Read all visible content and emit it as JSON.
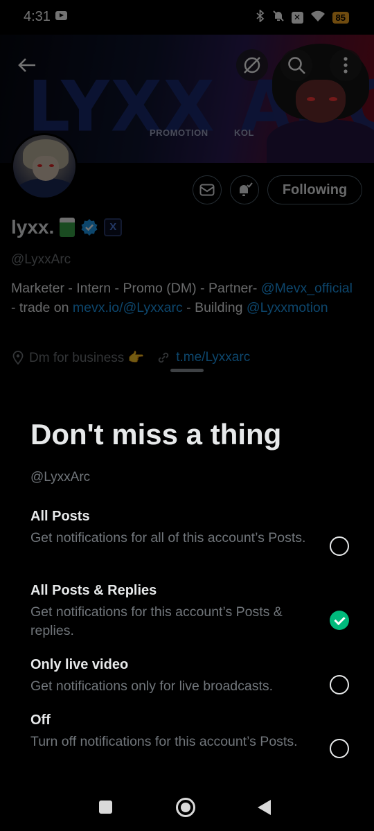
{
  "status_bar": {
    "time": "4:31",
    "battery": "85",
    "icons": [
      "youtube-icon",
      "bluetooth-icon",
      "bell-off-icon",
      "x-app-icon",
      "wifi-icon",
      "battery-icon"
    ]
  },
  "banner": {
    "title": "LYXX ARC",
    "tags": [
      "PROMOTION",
      "KOL"
    ]
  },
  "profile": {
    "name": "lyxx.",
    "handle": "@LyxxArc",
    "bio": {
      "part1": "Marketer - Intern - Promo (DM) - Partner- ",
      "link1": "@Mevx_official",
      "part2": " - trade on ",
      "link2": "mevx.io/@Lyxxarc",
      "part3": " - Building ",
      "link3": "@Lyxxmotion"
    },
    "location": "Dm for business 👉",
    "url": "t.me/Lyxxarc",
    "following_label": "Following",
    "badge_label": "X"
  },
  "sheet": {
    "title": "Don't miss a thing",
    "handle": "@LyxxArc",
    "options": [
      {
        "title": "All Posts",
        "desc": "Get notifications for all of this account’s Posts.",
        "checked": false
      },
      {
        "title": "All Posts & Replies",
        "desc": "Get notifications for this account’s Posts & replies.",
        "checked": true
      },
      {
        "title": "Only live video",
        "desc": "Get notifications only for live broadcasts.",
        "checked": false
      },
      {
        "title": "Off",
        "desc": "Turn off notifications for this account’s Posts.",
        "checked": false
      }
    ]
  },
  "colors": {
    "link": "#1d9bf0",
    "checked": "#00ba7c",
    "muted": "#71767b"
  }
}
